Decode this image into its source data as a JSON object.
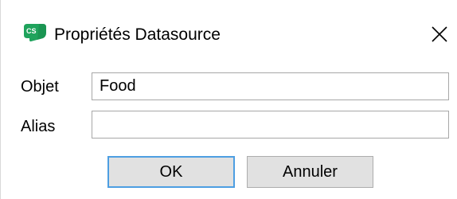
{
  "window": {
    "title": "Propriétés Datasource",
    "icon": "cs-app-icon",
    "icon_text": "CS",
    "close_icon": "close-icon",
    "accent": "#1fa35c"
  },
  "form": {
    "object_label": "Objet",
    "object_value": "Food",
    "alias_label": "Alias",
    "alias_value": ""
  },
  "buttons": {
    "ok_label": "OK",
    "cancel_label": "Annuler"
  }
}
